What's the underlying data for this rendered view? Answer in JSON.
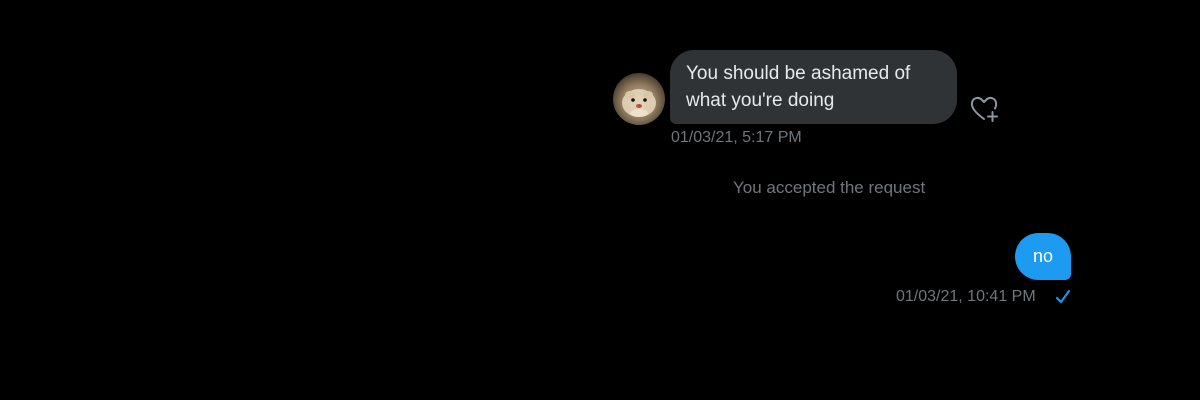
{
  "conversation": {
    "incoming": {
      "text_line1": "You should be ashamed of",
      "text_line2": "what you're doing",
      "timestamp": "01/03/21, 5:17 PM",
      "react_icon": "heart-plus-icon",
      "avatar_icon": "hamster-avatar"
    },
    "system_message": "You accepted the request",
    "outgoing": {
      "text": "no",
      "timestamp": "01/03/21, 10:41 PM",
      "status_icon": "checkmark-icon"
    }
  },
  "colors": {
    "background": "#000000",
    "incoming_bubble": "#2f3336",
    "outgoing_bubble": "#1d9bf0",
    "muted_text": "#71767b",
    "accent": "#1d9bf0"
  }
}
